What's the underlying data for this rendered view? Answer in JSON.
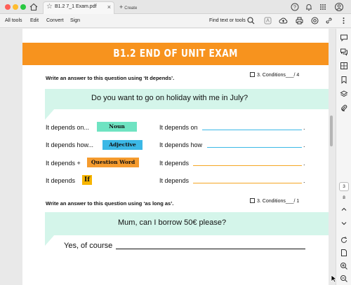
{
  "window": {
    "tab_title": "B1.2 7_1 Exam.pdf",
    "new_tab_label": "Create"
  },
  "toolbar": {
    "menus": [
      "All tools",
      "Edit",
      "Convert",
      "Sign"
    ],
    "find_label": "Find text or tools"
  },
  "document": {
    "banner": "B1.2 END OF UNIT EXAM",
    "section1": {
      "instruction": "Write an answer to this question using ‘It depends’.",
      "conditions": "3. Conditions___/ 4",
      "question": "Do you want to go on holiday with me in July?",
      "rows": [
        {
          "stem": "It depends on...",
          "tag": "Noun",
          "answer_stem": "It depends on"
        },
        {
          "stem": "It depends how...",
          "tag": "Adjective",
          "answer_stem": "It depends how"
        },
        {
          "stem": "It depends +",
          "tag": "Question Word",
          "answer_stem": "It depends"
        },
        {
          "stem": "It depends",
          "tag": "If",
          "answer_stem": "It depends"
        }
      ],
      "period": "."
    },
    "section2": {
      "instruction": "Write an answer to this question using ‘as long as’.",
      "conditions": "3. Conditions___/ 1",
      "question": "Mum, can I borrow 50€ please?",
      "answer_stem": "Yes, of course"
    }
  },
  "sidebar": {
    "current_page": "3",
    "total_pages": "8"
  },
  "colors": {
    "banner": "#f7931e",
    "question_box": "#d4f5ea",
    "noun": "#6fe3c2",
    "adjective": "#3bb8e6",
    "question_word": "#f59b2e",
    "if": "#f7b500"
  }
}
